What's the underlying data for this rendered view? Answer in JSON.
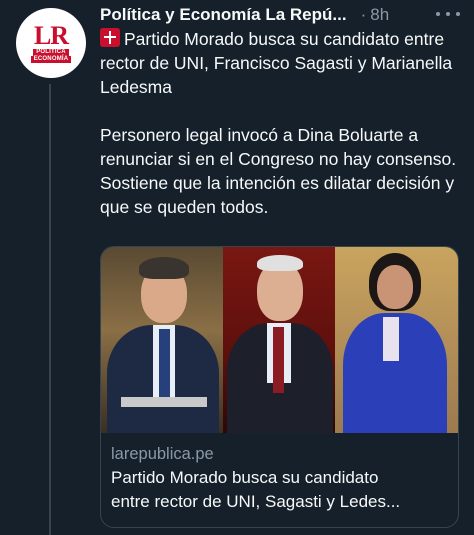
{
  "tweet": {
    "author_name": "Política y Economía La Repú...",
    "separator": "·",
    "time": "8h",
    "avatar": {
      "logo_text": "LR",
      "tagline_1": "POLÍTICA",
      "tagline_2": "ECONOMÍA"
    },
    "headline_emoji": "red-square-siren-icon",
    "text_line1": "Partido Morado busca su candidato entre rector de UNI, Francisco Sagasti y Marianella Ledesma",
    "text_line2": "Personero legal invocó a Dina Boluarte a renunciar si en el Congreso no hay consenso. Sostiene que la intención es dilatar decisión y que se queden todos."
  },
  "link_card": {
    "domain": "larepublica.pe",
    "title_line1": "Partido Morado busca su candidato",
    "title_line2": "entre rector de UNI, Sagasti y Ledes..."
  },
  "colors": {
    "background": "#15202b",
    "text_primary": "#f7f9f9",
    "text_secondary": "#8b98a5",
    "border": "#38444d",
    "brand_red": "#c8102e"
  }
}
